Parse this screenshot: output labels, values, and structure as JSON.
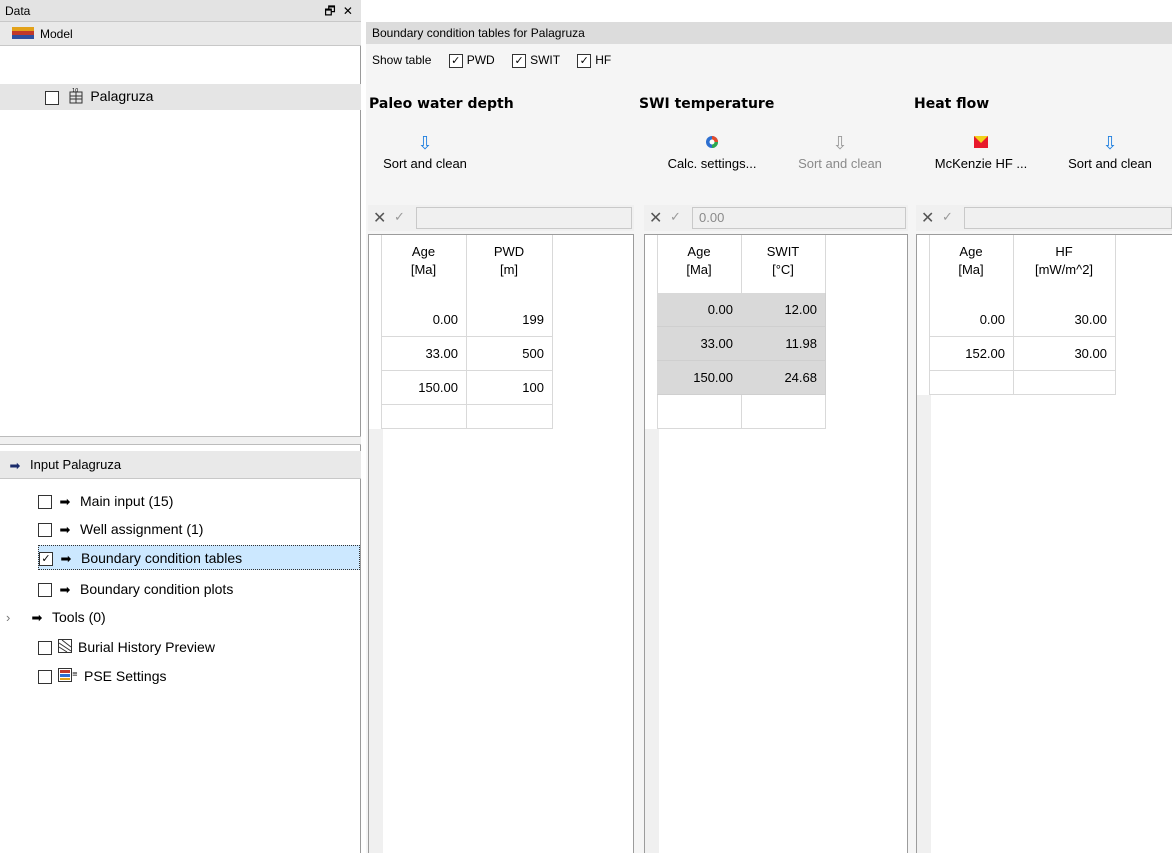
{
  "data_pane": {
    "title": "Data",
    "controls": "🗗 ✕",
    "model_label": "Model",
    "model_item": "Palagruza"
  },
  "input_pane": {
    "title": "Input Palagruza",
    "items": [
      {
        "label": "Main input (15)",
        "checked": false
      },
      {
        "label": "Well assignment (1)",
        "checked": false
      },
      {
        "label": "Boundary condition tables",
        "checked": true
      },
      {
        "label": "Boundary condition plots",
        "checked": false
      },
      {
        "label": "Tools (0)"
      },
      {
        "label": "Burial History Preview",
        "checked": false
      },
      {
        "label": "PSE Settings",
        "checked": false
      }
    ]
  },
  "main": {
    "title": "Boundary condition tables for Palagruza",
    "show_table_label": "Show table",
    "show_options": [
      {
        "label": "PWD",
        "checked": true
      },
      {
        "label": "SWIT",
        "checked": true
      },
      {
        "label": "HF",
        "checked": true
      }
    ]
  },
  "pwd": {
    "title": "Paleo water depth",
    "sort_label": "Sort and clean",
    "edit_value": "",
    "col1": "Age\n[Ma]",
    "col2": "PWD\n[m]",
    "col1_line1": "Age",
    "col1_line2": "[Ma]",
    "col2_line1": "PWD",
    "col2_line2": "[m]",
    "rows": [
      [
        "0.00",
        "199"
      ],
      [
        "33.00",
        "500"
      ],
      [
        "150.00",
        "100"
      ],
      [
        "",
        ""
      ]
    ]
  },
  "swit": {
    "title": "SWI temperature",
    "calc_label": "Calc. settings...",
    "sort_label": "Sort and clean",
    "edit_value": "0.00",
    "col1_line1": "Age",
    "col1_line2": "[Ma]",
    "col2_line1": "SWIT",
    "col2_line2": "[°C]",
    "rows": [
      [
        "0.00",
        "12.00"
      ],
      [
        "33.00",
        "11.98"
      ],
      [
        "150.00",
        "24.68"
      ],
      [
        "",
        ""
      ]
    ]
  },
  "hf": {
    "title": "Heat flow",
    "mckenzie_label": "McKenzie HF ...",
    "sort_label": "Sort and clean",
    "edit_value": "",
    "col1_line1": "Age",
    "col1_line2": "[Ma]",
    "col2_line1": "HF",
    "col2_line2": "[mW/m^2]",
    "rows": [
      [
        "0.00",
        "30.00"
      ],
      [
        "152.00",
        "30.00"
      ],
      [
        "",
        ""
      ]
    ]
  },
  "colors": {
    "accent_blue": "#1e7fe0",
    "selection": "#cce8ff",
    "gray_cell": "#d9d9d9"
  }
}
